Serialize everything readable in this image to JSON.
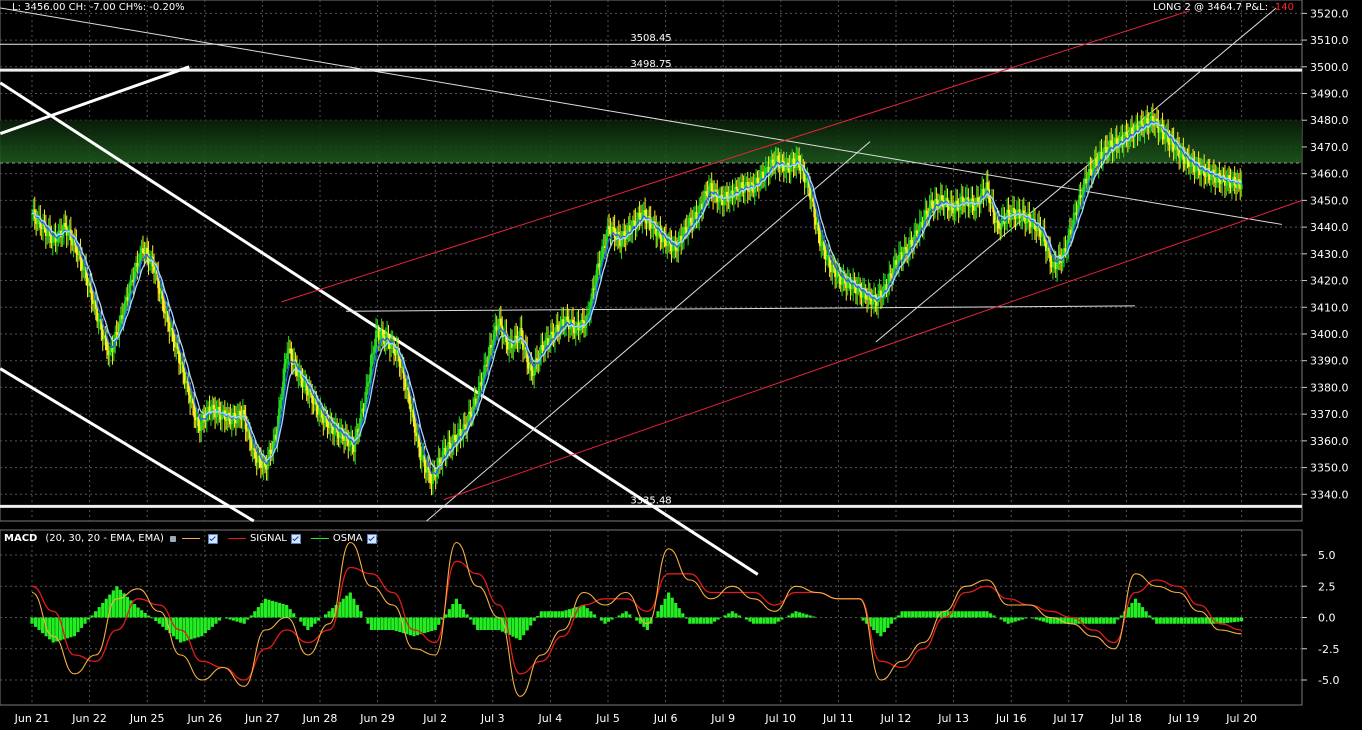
{
  "header": {
    "quote_text": "L: 3456.00 CH: -7.00 CH%: -0.20%",
    "position_text": "LONG 2 @ 3464.7 P&L: ",
    "pnl_value": "-140"
  },
  "indicator": {
    "name": "MACD",
    "params": "(20, 30, 20 - EMA, EMA)",
    "legend": [
      {
        "name": "",
        "color": "#f5b041"
      },
      {
        "name": "SIGNAL",
        "color": "#e31a1a"
      },
      {
        "name": "OSMA",
        "color": "#22ee22"
      }
    ]
  },
  "colors": {
    "background": "#000000",
    "grid": "#555555",
    "candle_up": "#22dd22",
    "candle_down": "#ffee22",
    "ma_fast": "#1e64ff",
    "ma_slow": "#aad8ff",
    "macd": "#f5b041",
    "signal": "#e31a1a",
    "osma": "#22ee22",
    "resistance_zone": "#1f5f1f"
  },
  "chart_data": [
    {
      "type": "candlestick",
      "title": "",
      "ylim": [
        3330,
        3525
      ],
      "y_ticks": [
        "3340.0",
        "3350.0",
        "3360.0",
        "3370.0",
        "3380.0",
        "3390.0",
        "3400.0",
        "3410.0",
        "3420.0",
        "3430.0",
        "3440.0",
        "3450.0",
        "3460.0",
        "3470.0",
        "3480.0",
        "3490.0",
        "3500.0",
        "3510.0",
        "3520.0"
      ],
      "x_ticks": [
        "Jun 21",
        "Jun 22",
        "Jun 25",
        "Jun 26",
        "Jun 27",
        "Jun 28",
        "Jun 29",
        "Jul 2",
        "Jul 3",
        "Jul 4",
        "Jul 5",
        "Jul 6",
        "Jul 9",
        "Jul 10",
        "Jul 11",
        "Jul 12",
        "Jul 13",
        "Jul 16",
        "Jul 17",
        "Jul 18",
        "Jul 19",
        "Jul 20"
      ],
      "close_path": [
        [
          "Jun 21",
          3445
        ],
        [
          "Jun 21",
          3440
        ],
        [
          "Jun 21",
          3435
        ],
        [
          "Jun 21",
          3440
        ],
        [
          "Jun 21",
          3432
        ],
        [
          "Jun 22",
          3420
        ],
        [
          "Jun 22",
          3405
        ],
        [
          "Jun 22",
          3392
        ],
        [
          "Jun 22",
          3405
        ],
        [
          "Jun 22",
          3420
        ],
        [
          "Jun 25",
          3432
        ],
        [
          "Jun 25",
          3425
        ],
        [
          "Jun 25",
          3408
        ],
        [
          "Jun 25",
          3395
        ],
        [
          "Jun 25",
          3380
        ],
        [
          "Jun 26",
          3365
        ],
        [
          "Jun 26",
          3372
        ],
        [
          "Jun 26",
          3370
        ],
        [
          "Jun 26",
          3368
        ],
        [
          "Jun 26",
          3370
        ],
        [
          "Jun 27",
          3355
        ],
        [
          "Jun 27",
          3350
        ],
        [
          "Jun 27",
          3362
        ],
        [
          "Jun 27",
          3395
        ],
        [
          "Jun 27",
          3385
        ],
        [
          "Jun 28",
          3378
        ],
        [
          "Jun 28",
          3370
        ],
        [
          "Jun 28",
          3365
        ],
        [
          "Jun 28",
          3362
        ],
        [
          "Jun 28",
          3358
        ],
        [
          "Jun 29",
          3375
        ],
        [
          "Jun 29",
          3400
        ],
        [
          "Jun 29",
          3398
        ],
        [
          "Jun 29",
          3392
        ],
        [
          "Jun 29",
          3375
        ],
        [
          "Jul 2",
          3355
        ],
        [
          "Jul 2",
          3345
        ],
        [
          "Jul 2",
          3355
        ],
        [
          "Jul 2",
          3360
        ],
        [
          "Jul 2",
          3365
        ],
        [
          "Jul 3",
          3375
        ],
        [
          "Jul 3",
          3390
        ],
        [
          "Jul 3",
          3405
        ],
        [
          "Jul 3",
          3395
        ],
        [
          "Jul 3",
          3400
        ],
        [
          "Jul 4",
          3385
        ],
        [
          "Jul 4",
          3395
        ],
        [
          "Jul 4",
          3400
        ],
        [
          "Jul 4",
          3405
        ],
        [
          "Jul 4",
          3402
        ],
        [
          "Jul 5",
          3405
        ],
        [
          "Jul 5",
          3425
        ],
        [
          "Jul 5",
          3440
        ],
        [
          "Jul 5",
          3435
        ],
        [
          "Jul 5",
          3440
        ],
        [
          "Jul 6",
          3445
        ],
        [
          "Jul 6",
          3440
        ],
        [
          "Jul 6",
          3435
        ],
        [
          "Jul 6",
          3432
        ],
        [
          "Jul 6",
          3440
        ],
        [
          "Jul 9",
          3445
        ],
        [
          "Jul 9",
          3455
        ],
        [
          "Jul 9",
          3450
        ],
        [
          "Jul 9",
          3452
        ],
        [
          "Jul 9",
          3455
        ],
        [
          "Jul 10",
          3455
        ],
        [
          "Jul 10",
          3460
        ],
        [
          "Jul 10",
          3465
        ],
        [
          "Jul 10",
          3462
        ],
        [
          "Jul 10",
          3465
        ],
        [
          "Jul 11",
          3455
        ],
        [
          "Jul 11",
          3435
        ],
        [
          "Jul 11",
          3425
        ],
        [
          "Jul 11",
          3420
        ],
        [
          "Jul 11",
          3418
        ],
        [
          "Jul 12",
          3415
        ],
        [
          "Jul 12",
          3412
        ],
        [
          "Jul 12",
          3418
        ],
        [
          "Jul 12",
          3428
        ],
        [
          "Jul 12",
          3432
        ],
        [
          "Jul 13",
          3440
        ],
        [
          "Jul 13",
          3448
        ],
        [
          "Jul 13",
          3450
        ],
        [
          "Jul 13",
          3447
        ],
        [
          "Jul 13",
          3450
        ],
        [
          "Jul 16",
          3448
        ],
        [
          "Jul 16",
          3455
        ],
        [
          "Jul 16",
          3440
        ],
        [
          "Jul 16",
          3445
        ],
        [
          "Jul 16",
          3445
        ],
        [
          "Jul 17",
          3442
        ],
        [
          "Jul 17",
          3438
        ],
        [
          "Jul 17",
          3425
        ],
        [
          "Jul 17",
          3430
        ],
        [
          "Jul 17",
          3445
        ],
        [
          "Jul 18",
          3458
        ],
        [
          "Jul 18",
          3465
        ],
        [
          "Jul 18",
          3470
        ],
        [
          "Jul 18",
          3472
        ],
        [
          "Jul 18",
          3475
        ],
        [
          "Jul 19",
          3478
        ],
        [
          "Jul 19",
          3480
        ],
        [
          "Jul 19",
          3475
        ],
        [
          "Jul 19",
          3470
        ],
        [
          "Jul 19",
          3465
        ],
        [
          "Jul 20",
          3462
        ],
        [
          "Jul 20",
          3460
        ],
        [
          "Jul 20",
          3458
        ],
        [
          "Jul 20",
          3457
        ],
        [
          "Jul 20",
          3456
        ]
      ],
      "horizontal_levels": [
        {
          "value": 3508.45,
          "label": "3508.45"
        },
        {
          "value": 3498.75,
          "label": "3498.75"
        },
        {
          "value": 3335.48,
          "label": "3335.48"
        }
      ],
      "resistance_zone": [
        3464,
        3480
      ]
    },
    {
      "type": "line",
      "title": "MACD",
      "ylim": [
        -7,
        7
      ],
      "y_ticks": [
        "5.0",
        "2.5",
        "0.0",
        "-2.5",
        "-5.0"
      ],
      "series": [
        {
          "name": "",
          "values": [
            2.0,
            -1.5,
            -4.5,
            -3.0,
            1.5,
            2.3,
            0.5,
            -3.0,
            -5.0,
            -4.0,
            -5.5,
            -1.0,
            0.0,
            -3.0,
            -0.5,
            6.0,
            2.5,
            1.0,
            -2.5,
            -3.0,
            6.0,
            2.5,
            0.0,
            -6.3,
            -3.0,
            -1.0,
            2.0,
            1.0,
            2.0,
            -0.5,
            5.5,
            3.0,
            1.5,
            2.5,
            1.5,
            0.5,
            2.5,
            2.0,
            1.5,
            1.5,
            -5.0,
            -3.5,
            -2.0,
            0.5,
            2.5,
            3.0,
            1.0,
            1.0,
            0.0,
            -0.5,
            -1.5,
            -2.5,
            3.5,
            2.5,
            2.0,
            0.5,
            -1.0,
            -1.3
          ]
        },
        {
          "name": "SIGNAL",
          "values": [
            2.5,
            0.5,
            -3.0,
            -3.5,
            -1.0,
            1.5,
            1.0,
            -1.0,
            -3.5,
            -4.0,
            -5.0,
            -2.5,
            -1.0,
            -2.0,
            -1.0,
            4.0,
            3.5,
            2.0,
            -1.0,
            -2.0,
            4.5,
            3.5,
            1.0,
            -4.5,
            -3.5,
            -1.5,
            1.0,
            1.5,
            1.5,
            0.5,
            3.5,
            3.5,
            2.0,
            2.0,
            2.0,
            1.0,
            2.0,
            2.0,
            1.5,
            1.5,
            -3.5,
            -4.0,
            -2.5,
            0.0,
            2.0,
            2.5,
            1.5,
            1.0,
            0.5,
            0.0,
            -1.0,
            -2.0,
            2.0,
            3.0,
            2.5,
            1.0,
            -0.5,
            -1.0
          ]
        },
        {
          "name": "OSMA",
          "values": [
            -0.5,
            -2.0,
            -1.5,
            0.5,
            2.5,
            0.8,
            -0.5,
            -2.0,
            -1.5,
            0.0,
            -0.5,
            1.5,
            1.0,
            -1.0,
            0.5,
            2.0,
            -1.0,
            -1.0,
            -1.5,
            -1.0,
            1.5,
            -1.0,
            -1.0,
            -1.8,
            0.5,
            0.5,
            1.0,
            -0.5,
            0.5,
            -1.0,
            2.0,
            -0.5,
            -0.5,
            0.5,
            -0.5,
            -0.5,
            0.5,
            0.0,
            0.0,
            0.0,
            -1.5,
            0.5,
            0.5,
            0.5,
            0.5,
            0.5,
            -0.5,
            0.0,
            -0.5,
            -0.5,
            -0.5,
            -0.5,
            1.5,
            -0.5,
            -0.5,
            -0.5,
            -0.5,
            -0.3
          ]
        }
      ]
    }
  ]
}
